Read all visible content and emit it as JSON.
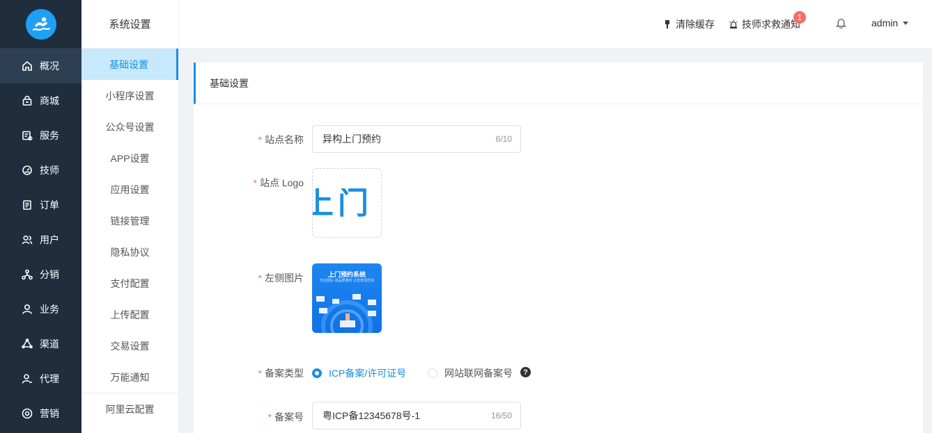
{
  "sidebar": {
    "logo_icon": "swimmer-logo-icon",
    "items": [
      {
        "label": "概况",
        "icon": "home-icon"
      },
      {
        "label": "商城",
        "icon": "shop-bag-icon"
      },
      {
        "label": "服务",
        "icon": "service-list-icon"
      },
      {
        "label": "技师",
        "icon": "dashboard-icon"
      },
      {
        "label": "订单",
        "icon": "document-icon"
      },
      {
        "label": "用户",
        "icon": "users-icon"
      },
      {
        "label": "分销",
        "icon": "network-icon"
      },
      {
        "label": "业务",
        "icon": "user-icon"
      },
      {
        "label": "渠道",
        "icon": "channel-icon"
      },
      {
        "label": "代理",
        "icon": "agent-icon"
      },
      {
        "label": "营销",
        "icon": "marketing-icon"
      }
    ]
  },
  "submenu": {
    "title": "系统设置",
    "items": [
      "基础设置",
      "小程序设置",
      "公众号设置",
      "APP设置",
      "应用设置",
      "链接管理",
      "隐私协议",
      "支付配置",
      "上传配置",
      "交易设置",
      "万能通知",
      "阿里云配置"
    ]
  },
  "header": {
    "clear_cache": "清除缓存",
    "rescue_notice": "技师求救通知",
    "rescue_badge": "1",
    "user": "admin"
  },
  "card": {
    "title": "基础设置"
  },
  "form": {
    "site_name_label": "站点名称",
    "site_name_value": "异构上门预约",
    "site_name_count": "6/10",
    "site_logo_label": "站点 Logo",
    "logo_text": "上门",
    "left_image_label": "左侧图片",
    "left_image_title": "上门预约系统",
    "left_image_subtitle": "专业团队·高品质服务 让您享受舒适",
    "record_type_label": "备案类型",
    "record_type_option1": "ICP备案/许可证号",
    "record_type_option2": "网站联网备案号",
    "record_type_help": "?",
    "record_no_label": "备案号",
    "record_no_value": "粤ICP备12345678号-1",
    "record_no_count": "16/50"
  },
  "colors": {
    "sidebar_bg": "#1f2d3d",
    "accent": "#1a8fe0",
    "required": "#f56c6c",
    "badge": "#f56c6c"
  }
}
